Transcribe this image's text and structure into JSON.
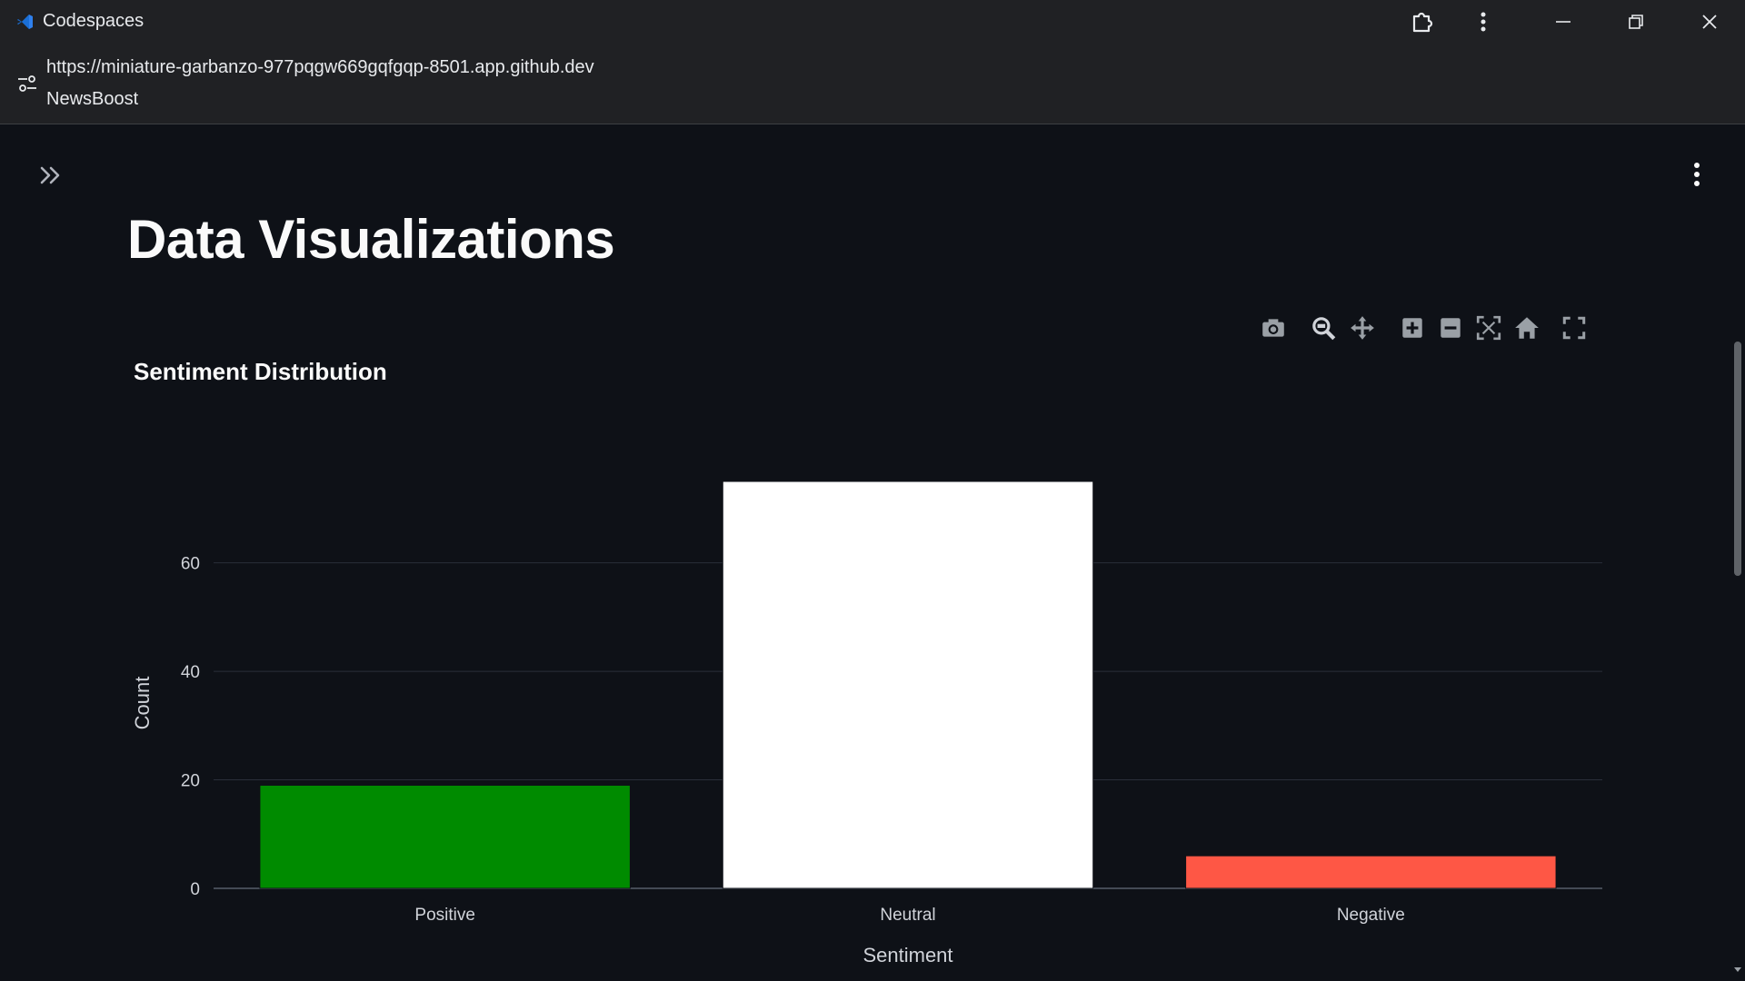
{
  "window": {
    "app_title": "Codespaces",
    "buttons": [
      "extensions-icon",
      "more-vert-icon",
      "minimize-icon",
      "restore-icon",
      "close-icon"
    ]
  },
  "address": {
    "url": "https://miniature-garbanzo-977pqgw669gqfgqp-8501.app.github.dev",
    "page_title": "NewsBoost"
  },
  "page": {
    "heading": "Data Visualizations"
  },
  "modebar": [
    "camera-icon",
    "zoom-icon",
    "pan-icon",
    "zoom-in-icon",
    "zoom-out-icon",
    "autoscale-icon",
    "reset-axes-icon",
    "fullscreen-icon"
  ],
  "chart_data": {
    "type": "bar",
    "title": "Sentiment Distribution",
    "xlabel": "Sentiment",
    "ylabel": "Count",
    "categories": [
      "Positive",
      "Neutral",
      "Negative"
    ],
    "values": [
      19,
      75,
      6
    ],
    "colors": [
      "#008b00",
      "#ffffff",
      "#fe5745"
    ],
    "ylim": [
      0,
      75
    ],
    "yticks": [
      0,
      20,
      40,
      60
    ],
    "grid": true
  },
  "colors": {
    "background": "#0e1117",
    "chrome": "#202124",
    "gridline": "#2a2f3a",
    "text": "#fafafa",
    "icon_muted": "#9aa0a6"
  }
}
